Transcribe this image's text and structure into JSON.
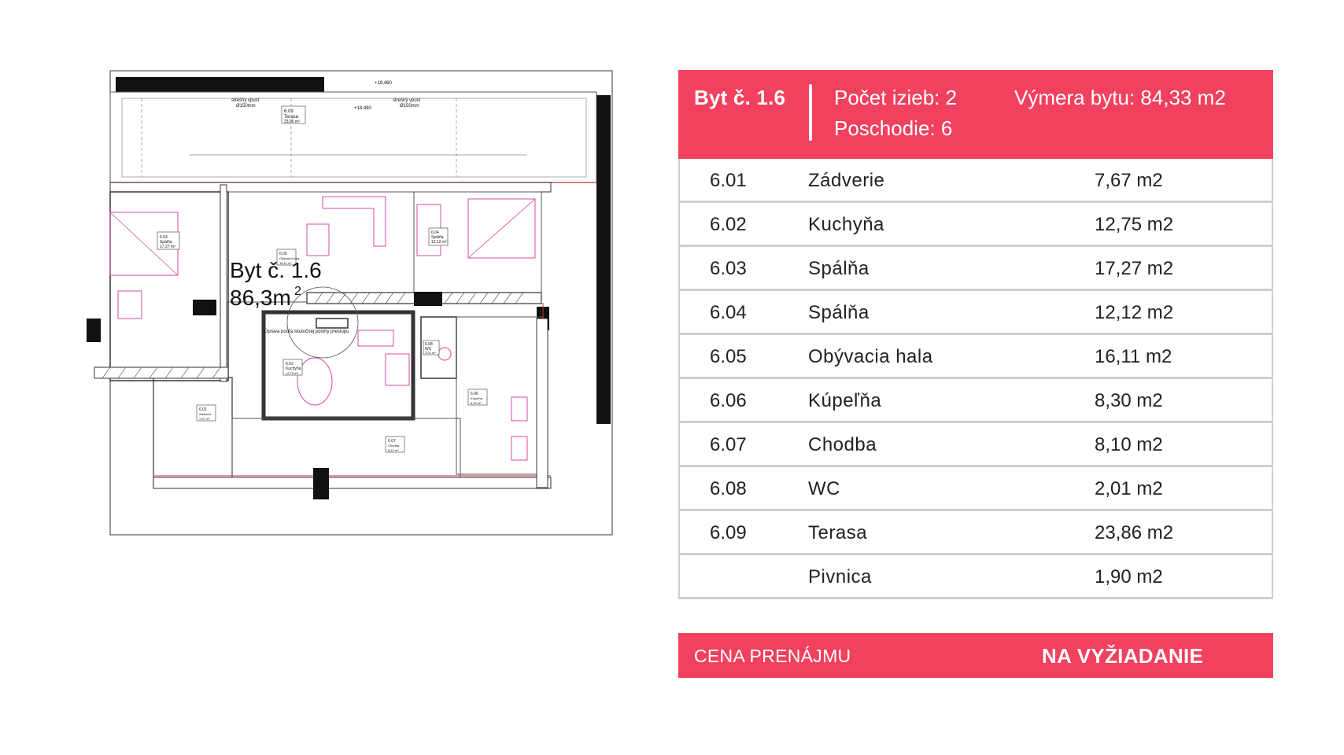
{
  "plan": {
    "unit_label": "Byt č. 1.6",
    "unit_area": "86,3m",
    "unit_area_sup": "2",
    "rooms": [
      {
        "code": "6.03",
        "name": "Spálňa",
        "area": "17,27 m²"
      },
      {
        "code": "6.04",
        "name": "Spálňa",
        "area": "12,12 m²"
      },
      {
        "code": "6.05",
        "name": "Obývacia hala",
        "area": "16,11 m²"
      },
      {
        "code": "6.02",
        "name": "Kuchyňa",
        "area": "12,75 m²"
      },
      {
        "code": "6.08",
        "name": "WC",
        "area": "2,01 m²"
      },
      {
        "code": "6.06",
        "name": "Kúpeľňa",
        "area": "8,30 m²"
      },
      {
        "code": "6.01",
        "name": "Zádverie",
        "area": "7,67 m²"
      },
      {
        "code": "6.07",
        "name": "Chodba",
        "area": "8,10 m²"
      },
      {
        "code": "6.09",
        "name": "Terasa",
        "area": "23,86 m²"
      }
    ],
    "notes": [
      "strešný vpust",
      "Ø150mm",
      "+19,460",
      "+18,490",
      "Úprava podľa skutočnej polohy prestupu"
    ]
  },
  "card": {
    "title": "Byt č. 1.6",
    "rooms_count": "Počet izieb: 2",
    "floor": "Poschodie: 6",
    "total_area": "Výmera bytu: 84,33 m2",
    "rows": [
      {
        "num": "6.01",
        "name": "Zádverie",
        "area": "7,67 m2"
      },
      {
        "num": "6.02",
        "name": "Kuchyňa",
        "area": "12,75 m2"
      },
      {
        "num": "6.03",
        "name": "Spálňa",
        "area": "17,27 m2"
      },
      {
        "num": "6.04",
        "name": "Spálňa",
        "area": "12,12 m2"
      },
      {
        "num": "6.05",
        "name": "Obývacia hala",
        "area": "16,11 m2"
      },
      {
        "num": "6.06",
        "name": "Kúpeľňa",
        "area": "8,30 m2"
      },
      {
        "num": "6.07",
        "name": "Chodba",
        "area": "8,10 m2"
      },
      {
        "num": "6.08",
        "name": "WC",
        "area": "2,01 m2"
      },
      {
        "num": "6.09",
        "name": "Terasa",
        "area": "23,86 m2"
      },
      {
        "num": "",
        "name": "Pivnica",
        "area": "1,90 m2"
      }
    ],
    "price_label": "CENA PRENÁJMU",
    "price_value": "NA VYŽIADANIE"
  },
  "colors": {
    "accent": "#f2405f",
    "plan_pink": "#d94aa0",
    "plan_red": "#c0392b",
    "divider": "#cfcfcf"
  }
}
